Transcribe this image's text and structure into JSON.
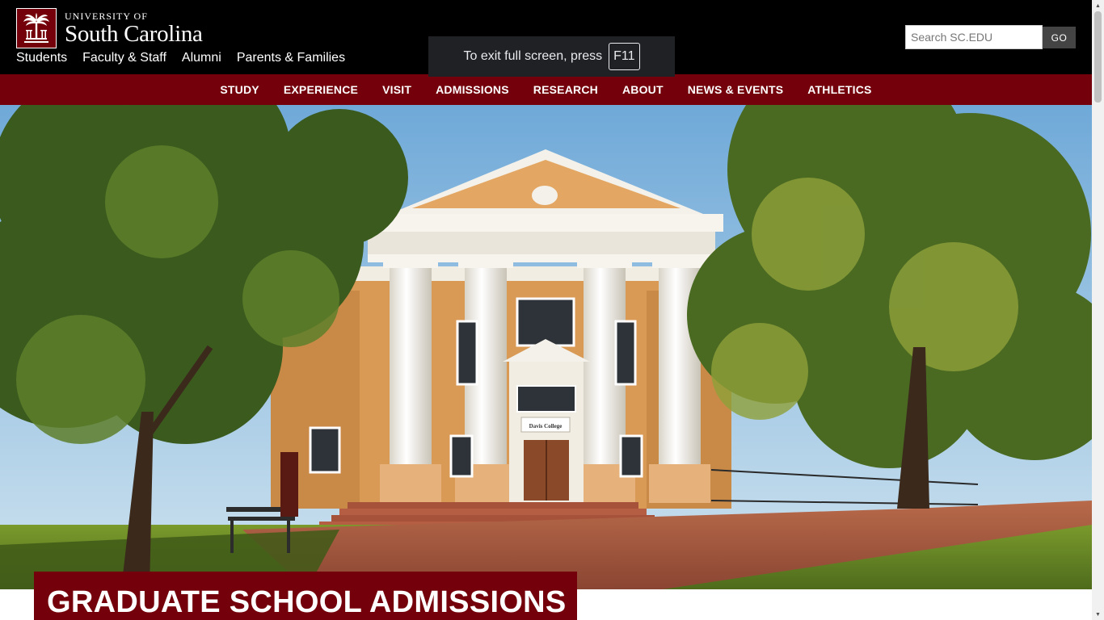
{
  "header": {
    "logo": {
      "top_line": "UNIVERSITY OF",
      "main_line": "South Carolina"
    },
    "audience_links": [
      "Students",
      "Faculty & Staff",
      "Alumni",
      "Parents & Families"
    ],
    "search": {
      "placeholder": "Search SC.EDU",
      "button_label": "GO"
    }
  },
  "fullscreen_notice": {
    "text": "To exit full screen, press",
    "key": "F11"
  },
  "main_nav": [
    "STUDY",
    "EXPERIENCE",
    "VISIT",
    "ADMISSIONS",
    "RESEARCH",
    "ABOUT",
    "NEWS & EVENTS",
    "ATHLETICS"
  ],
  "hero": {
    "building_sign": "Davis College"
  },
  "page": {
    "title": "GRADUATE SCHOOL ADMISSIONS"
  },
  "colors": {
    "garnet": "#73000a",
    "black": "#000000",
    "white": "#ffffff"
  }
}
